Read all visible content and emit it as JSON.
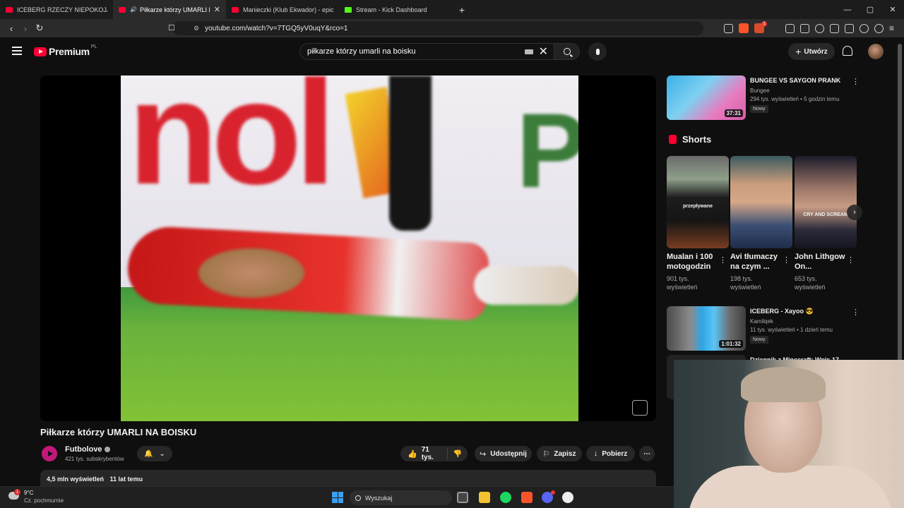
{
  "browser": {
    "tabs": [
      {
        "title": "ICEBERG RZECZY NIEPOKOJĄCYCH (",
        "favicon": "youtube-icon"
      },
      {
        "title": "Piłkarze którzy UMARLI NA B",
        "favicon": "youtube-icon",
        "active": true,
        "audio": true
      },
      {
        "title": "Manieczki (Klub Ekwador) - epicki se",
        "favicon": "youtube-icon"
      },
      {
        "title": "Stream - Kick Dashboard",
        "favicon": "kick-icon"
      }
    ],
    "new_tab": "+",
    "url": "youtube.com/watch?v=7TGQ5yV0uqY&rco=1",
    "window_controls": {
      "minimize": "—",
      "maximize": "▢",
      "close": "✕"
    }
  },
  "header": {
    "logo": "Premium",
    "region": "PL",
    "search_query": "piłkarze którzy umarli na boisku",
    "create_label": "Utwórz"
  },
  "video": {
    "title": "Piłkarze którzy UMARLI NA BOISKU",
    "channel": "Futbolove",
    "subscribers": "421 tys. subskrybentów",
    "likes": "71 tys.",
    "share_label": "Udostępnij",
    "save_label": "Zapisz",
    "download_label": "Pobierz",
    "views": "4,5 mln wyświetleń",
    "age": "11 lat temu"
  },
  "sidebar": {
    "recommended": [
      {
        "title": "BUNGEE VS SAYGON PRANK",
        "channel": "Bungee",
        "stats": "294 tys. wyświetleń • 5 godzin temu",
        "badge": "Nowy",
        "duration": "37:31"
      },
      {
        "title": "ICEBERG - Xayoo 😎",
        "channel": "Kamilqek",
        "stats": "11 tys. wyświetleń • 1 dzień temu",
        "badge": "Nowy",
        "duration": "1:01:32"
      },
      {
        "title": "Dziennik z Minecraft: Wpis 17",
        "channel": "",
        "stats": "",
        "badge": "",
        "duration": ""
      }
    ],
    "shorts_title": "Shorts",
    "shorts": [
      {
        "title": "Mualan i 100 motogodzin",
        "views": "901 tys. wyświetleń",
        "overlay": "przepływane"
      },
      {
        "title": "Avi tłumaczy na czym ...",
        "views": "198 tys. wyświetleń",
        "overlay": ""
      },
      {
        "title": "John Lithgow On...",
        "views": "653 tys. wyświetleń",
        "overlay": "CRY AND SCREAM"
      }
    ]
  },
  "taskbar": {
    "temperature": "9°C",
    "weather": "Cz. pochmurnie",
    "search_placeholder": "Wyszukaj"
  },
  "colors": {
    "accent": "#ff0033",
    "background": "#0f0f0f",
    "chip": "#272727"
  }
}
